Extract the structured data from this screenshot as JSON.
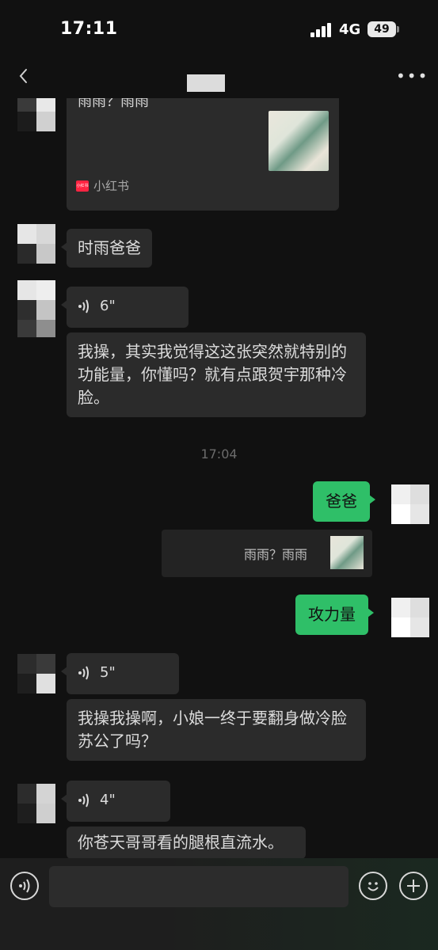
{
  "status_bar": {
    "time": "17:11",
    "network": "4G",
    "battery": "49"
  },
  "header": {
    "back_icon": "chevron-left-icon",
    "more_icon": "more-horizontal-icon",
    "more_label": "•••"
  },
  "messages": [
    {
      "side": "incoming",
      "type": "card",
      "title": "雨雨？雨雨",
      "source": "小红书",
      "source_logo_text": "小红书"
    },
    {
      "side": "incoming",
      "type": "text",
      "text": "时雨爸爸"
    },
    {
      "side": "incoming",
      "type": "voice",
      "duration": "6\""
    },
    {
      "side": "incoming",
      "type": "text",
      "text": "我操，其实我觉得这这张突然就特别的功能量，你懂吗？就有点跟贺宇那种冷脸。"
    },
    {
      "type": "time",
      "text": "17:04"
    },
    {
      "side": "outgoing",
      "type": "text",
      "text": "爸爸"
    },
    {
      "side": "outgoing",
      "type": "quote",
      "text": "雨雨？雨雨"
    },
    {
      "side": "outgoing",
      "type": "text",
      "text": "攻力量"
    },
    {
      "side": "incoming",
      "type": "voice",
      "duration": "5\""
    },
    {
      "side": "incoming",
      "type": "text",
      "text": "我操我操啊，小娘一终于要翻身做冷脸苏公了吗？"
    },
    {
      "side": "incoming",
      "type": "voice",
      "duration": "4\""
    },
    {
      "side": "incoming",
      "type": "text",
      "text": "你苍天哥哥看的腿根直流水。"
    }
  ],
  "input_bar": {
    "voice_icon": "voice-icon",
    "emoji_icon": "emoji-icon",
    "plus_icon": "plus-icon",
    "placeholder": ""
  },
  "colors": {
    "background": "#111111",
    "incoming_bubble": "#2b2b2b",
    "outgoing_bubble": "#2fbf68",
    "xiaohongshu_red": "#ff2442"
  }
}
